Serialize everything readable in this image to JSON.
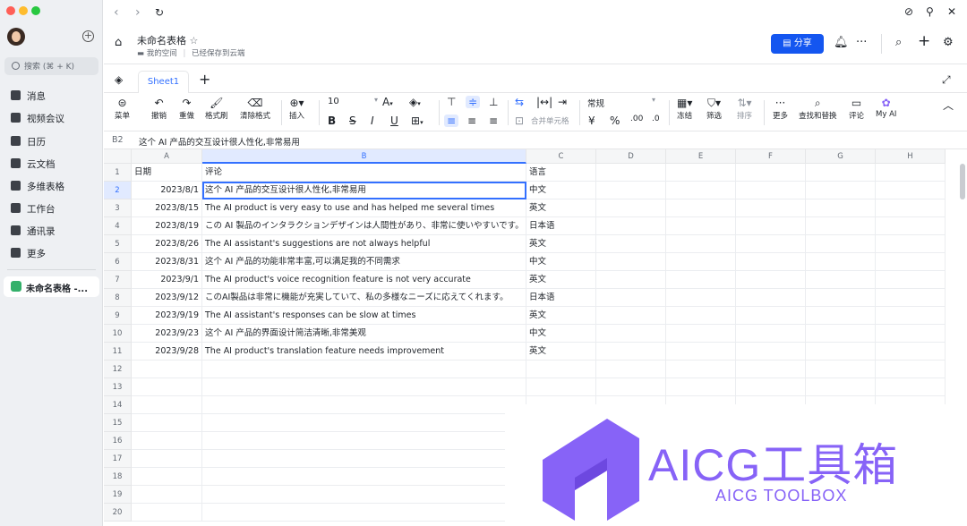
{
  "sidebar": {
    "search_label": "搜索 (⌘ + K)",
    "items": [
      {
        "label": "消息",
        "icon": "chat-bubble-icon"
      },
      {
        "label": "视频会议",
        "icon": "video-camera-icon"
      },
      {
        "label": "日历",
        "icon": "calendar-icon"
      },
      {
        "label": "云文档",
        "icon": "cloud-doc-icon"
      },
      {
        "label": "多维表格",
        "icon": "base-table-icon"
      },
      {
        "label": "工作台",
        "icon": "workplace-grid-icon"
      },
      {
        "label": "通讯录",
        "icon": "contacts-icon"
      },
      {
        "label": "更多",
        "icon": "more-apps-icon"
      }
    ],
    "open_doc": "未命名表格 -..."
  },
  "header": {
    "title": "未命名表格",
    "location": "我的空间",
    "save_status": "已经保存到云端",
    "share_label": "分享"
  },
  "sheet_tab": "Sheet1",
  "toolbar": {
    "menu": "菜单",
    "undo": "撤销",
    "redo": "重做",
    "format_painter": "格式刷",
    "clear_format": "清除格式",
    "insert": "插入",
    "font_size": "10",
    "merge": "合并单元格",
    "number_format": "常规",
    "freeze": "冻结",
    "filter": "筛选",
    "sort": "排序",
    "more": "更多",
    "find_replace": "查找和替换",
    "comment": "评论",
    "my_ai": "My AI"
  },
  "formula_bar": {
    "cell_ref": "B2",
    "content": "这个 AI 产品的交互设计很人性化,非常易用"
  },
  "grid": {
    "columns": [
      "A",
      "B",
      "C",
      "D",
      "E",
      "F",
      "G",
      "H"
    ],
    "row_numbers": [
      "1",
      "2",
      "3",
      "4",
      "5",
      "6",
      "7",
      "8",
      "9",
      "10",
      "11",
      "12",
      "13",
      "14",
      "15",
      "16",
      "17",
      "18",
      "19",
      "20"
    ],
    "header_row": [
      "日期",
      "评论",
      "语言"
    ],
    "rows": [
      [
        "2023/8/1",
        "这个 AI 产品的交互设计很人性化,非常易用",
        "中文"
      ],
      [
        "2023/8/15",
        "The AI product is very easy to use and has helped me several times",
        "英文"
      ],
      [
        "2023/8/19",
        "この AI 製品のインタラクションデザインは人間性があり、非常に使いやすいです。",
        "日本语"
      ],
      [
        "2023/8/26",
        "The AI assistant's suggestions are not always helpful",
        "英文"
      ],
      [
        "2023/8/31",
        "这个 AI 产品的功能非常丰富,可以满足我的不同需求",
        "中文"
      ],
      [
        "2023/9/1",
        "The AI product's voice recognition feature is not very accurate",
        "英文"
      ],
      [
        "2023/9/12",
        "このAI製品は非常に機能が充実していて、私の多様なニーズに応えてくれます。",
        "日本语"
      ],
      [
        "2023/9/19",
        "The AI assistant's responses can be slow at times",
        "英文"
      ],
      [
        "2023/9/23",
        "这个 AI 产品的界面设计简洁清晰,非常美观",
        "中文"
      ],
      [
        "2023/9/28",
        "The AI product's translation feature needs improvement",
        "英文"
      ]
    ]
  },
  "watermark": {
    "title": "AICG工具箱",
    "subtitle": "AICG TOOLBOX"
  },
  "colors": {
    "accent": "#3370ff",
    "share": "#1456f0",
    "watermark": "#8763f7",
    "doc_icon": "#33b06a"
  }
}
